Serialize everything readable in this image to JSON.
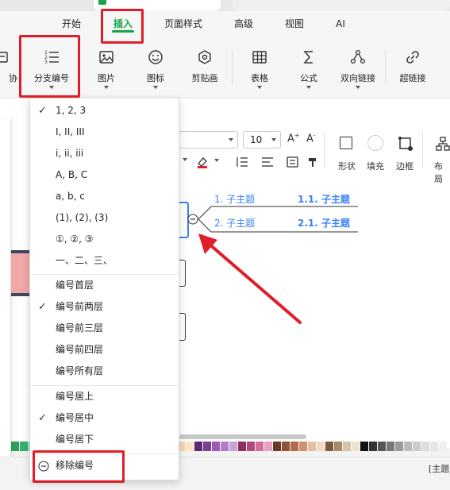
{
  "ribbon": {
    "tabs": [
      {
        "label": "开始"
      },
      {
        "label": "插入"
      },
      {
        "label": "页面样式"
      },
      {
        "label": "高级"
      },
      {
        "label": "视图"
      },
      {
        "label": "AI"
      }
    ]
  },
  "toolbar": {
    "partial_label": "协",
    "numbering_label": "分支编号",
    "picture_label": "图片",
    "icon_label": "图标",
    "clipart_label": "剪贴画",
    "table_label": "表格",
    "formula_label": "公式",
    "bilink_label": "双向链接",
    "hyperlink_label": "超链接"
  },
  "format": {
    "font_size": "10",
    "shape_label": "形状",
    "fill_label": "填充",
    "border_label": "边框",
    "layout_label": "布局"
  },
  "mindmap": {
    "topic1": "1. 子主题",
    "topic1_num": "1.1. 子主题",
    "topic2": "2. 子主题",
    "topic2_num": "2.1. 子主题"
  },
  "menu": {
    "styles": [
      {
        "label": "1, 2, 3",
        "check": "✓"
      },
      {
        "label": "I, II, III",
        "check": ""
      },
      {
        "label": "i, ii, iii",
        "check": ""
      },
      {
        "label": "A, B, C",
        "check": ""
      },
      {
        "label": "a, b, c",
        "check": ""
      },
      {
        "label": "(1), (2), (3)",
        "check": ""
      },
      {
        "label": "①, ②, ③",
        "check": ""
      },
      {
        "label": "一、二、三、",
        "check": ""
      }
    ],
    "levels": [
      {
        "label": "编号首层",
        "check": ""
      },
      {
        "label": "编号前两层",
        "check": "✓"
      },
      {
        "label": "编号前三层",
        "check": ""
      },
      {
        "label": "编号前四层",
        "check": ""
      },
      {
        "label": "编号所有层",
        "check": ""
      }
    ],
    "alignments": [
      {
        "label": "编号居上",
        "check": ""
      },
      {
        "label": "编号居中",
        "check": "✓"
      },
      {
        "label": "编号居下",
        "check": ""
      }
    ],
    "remove_label": "移除编号"
  },
  "status": {
    "topic_label": "[主题"
  },
  "colors": {
    "accent": "#16a34a",
    "topic_blue": "#3b82f6",
    "annotation_red": "#e11d2a"
  }
}
